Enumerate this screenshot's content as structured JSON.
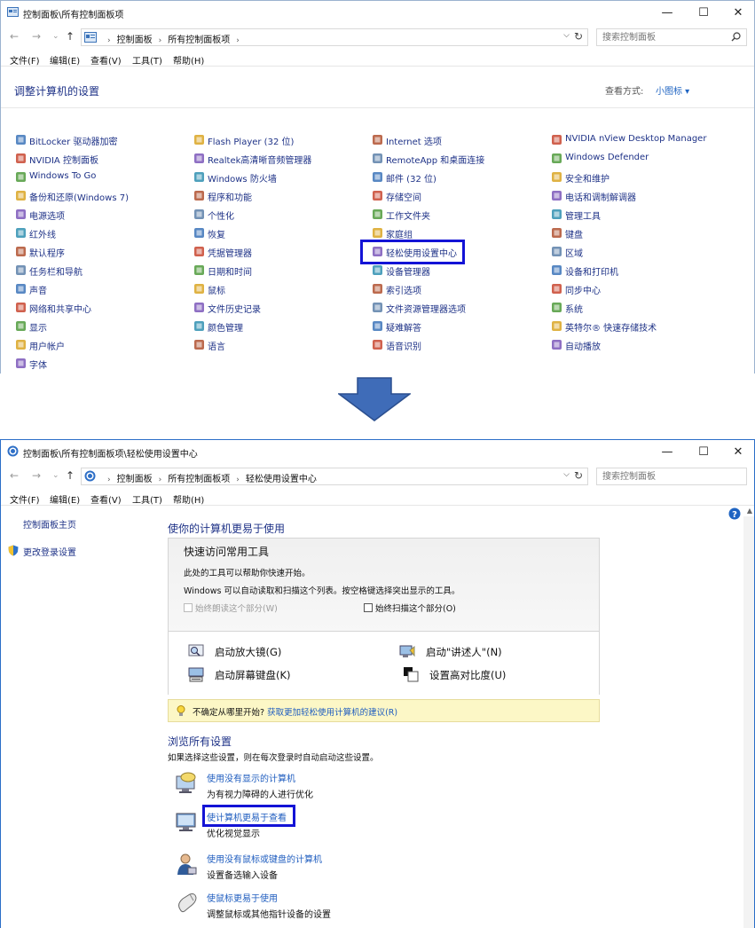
{
  "common": {
    "menu": [
      "文件(F)",
      "编辑(E)",
      "查看(V)",
      "工具(T)",
      "帮助(H)"
    ],
    "search_placeholder": "搜索控制面板",
    "window_buttons": {
      "minimize": "—",
      "maximize": "☐",
      "close": "✕"
    },
    "nav": {
      "back": "←",
      "forward": "→",
      "recent": "⌄",
      "up": "↑"
    }
  },
  "window1": {
    "title": "控制面板\\所有控制面板项",
    "breadcrumbs": [
      "控制面板",
      "所有控制面板项"
    ],
    "page_title": "调整计算机的设置",
    "view_by_label": "查看方式:",
    "view_by_value": "小图标 ▾",
    "columns": [
      [
        "BitLocker 驱动器加密",
        "NVIDIA 控制面板",
        "Windows To Go",
        "备份和还原(Windows 7)",
        "电源选项",
        "红外线",
        "默认程序",
        "任务栏和导航",
        "声音",
        "网络和共享中心",
        "显示",
        "用户帐户",
        "字体"
      ],
      [
        "Flash Player (32 位)",
        "Realtek高清晰音频管理器",
        "Windows 防火墙",
        "程序和功能",
        "个性化",
        "恢复",
        "凭据管理器",
        "日期和时间",
        "鼠标",
        "文件历史记录",
        "颜色管理",
        "语言"
      ],
      [
        "Internet 选项",
        "RemoteApp 和桌面连接",
        "邮件 (32 位)",
        "存储空间",
        "工作文件夹",
        "家庭组",
        "轻松使用设置中心",
        "设备管理器",
        "索引选项",
        "文件资源管理器选项",
        "疑难解答",
        "语音识别"
      ],
      [
        "NVIDIA nView Desktop Manager",
        "Windows Defender",
        "安全和维护",
        "电话和调制解调器",
        "管理工具",
        "键盘",
        "区域",
        "设备和打印机",
        "同步中心",
        "系统",
        "英特尔® 快速存储技术",
        "自动播放"
      ]
    ]
  },
  "window2": {
    "title": "控制面板\\所有控制面板项\\轻松使用设置中心",
    "breadcrumbs": [
      "控制面板",
      "所有控制面板项",
      "轻松使用设置中心"
    ],
    "sidebar": {
      "home": "控制面板主页",
      "change_logon": "更改登录设置"
    },
    "main_title": "使你的计算机更易于使用",
    "quick_access": {
      "title": "快速访问常用工具",
      "desc1": "此处的工具可以帮助你快速开始。",
      "desc2": "Windows 可以自动读取和扫描这个列表。按空格键选择突出显示的工具。",
      "check_read": "始终朗读这个部分(W)",
      "check_scan": "始终扫描这个部分(O)",
      "tools": [
        "启动放大镜(G)",
        "启动\"讲述人\"(N)",
        "启动屏幕键盘(K)",
        "设置高对比度(U)"
      ]
    },
    "tip": {
      "prefix": "不确定从哪里开始?",
      "link": "获取更加轻松使用计算机的建议(R)"
    },
    "browse": {
      "title": "浏览所有设置",
      "desc": "如果选择这些设置，则在每次登录时自动启动这些设置。",
      "items": [
        {
          "link": "使用没有显示的计算机",
          "desc": "为有视力障碍的人进行优化"
        },
        {
          "link": "使计算机更易于查看",
          "desc": "优化视觉显示"
        },
        {
          "link": "使用没有鼠标或键盘的计算机",
          "desc": "设置备选输入设备"
        },
        {
          "link": "使鼠标更易于使用",
          "desc": "调整鼠标或其他指针设备的设置"
        }
      ]
    }
  }
}
